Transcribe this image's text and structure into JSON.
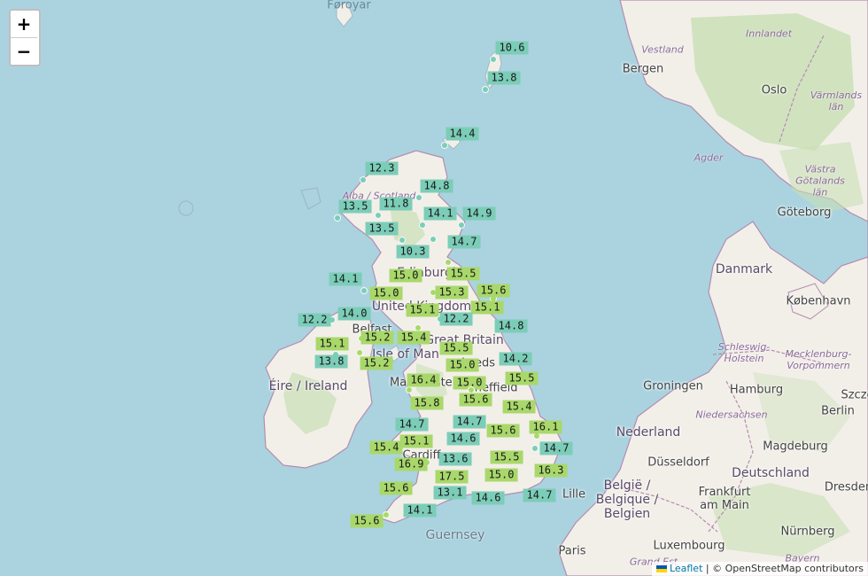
{
  "map": {
    "zoom_in_label": "+",
    "zoom_out_label": "−",
    "attribution": {
      "leaflet_link": "Leaflet",
      "separator": " | ",
      "credit": "© OpenStreetMap contributors"
    },
    "colors": {
      "sea": "#aad3df",
      "land": "#f2efe9",
      "forest": "#c8dfb4",
      "border": "#b48cb0",
      "marker_cool": "#7ccdb8",
      "marker_warm": "#a9d86a"
    },
    "places": {
      "foroyar": "Føroyar",
      "bergen": "Bergen",
      "vestland": "Vestland",
      "innlandet": "Innlandet",
      "oslo": "Oslo",
      "varmlands_lan": "Värmlands\nlän",
      "agder": "Agder",
      "vastra_gotalands_lan": "Västra Götalands\nlän",
      "goteborg": "Göteborg",
      "danmark": "Danmark",
      "kobenhavn": "København",
      "schleswig_holstein": "Schleswig-\nHolstein",
      "mecklenburg": "Mecklenburg-\nVorpommern",
      "hamburg": "Hamburg",
      "groningen": "Groningen",
      "szcz": "Szcze",
      "berlin": "Berlin",
      "niedersachsen": "Niedersachsen",
      "nederland": "Nederland",
      "magdeburg": "Magdeburg",
      "dusseldorf": "Düsseldorf",
      "deutschland": "Deutschland",
      "dresden": "Dresden",
      "belgie": "België /\nBelgique /\nBelgien",
      "frankfurt": "Frankfurt\nam Main",
      "lille": "Lille",
      "luxembourg": "Luxembourg",
      "nurnberg": "Nürnberg",
      "paris": "Paris",
      "grand_est": "Grand Est",
      "bayern": "Bayern",
      "guernsey": "Guernsey",
      "eire_ireland": "Éire / Ireland",
      "isle_of_man": "Isle of Man",
      "alba_scotland": "Alba / Scotland",
      "edinburgh": "Edinburgh",
      "united_kingdom": "United Kingdom",
      "belfast": "Belfast",
      "great_britain": "Great Britain",
      "leeds": "Leeds",
      "sheffield": "Sheffield",
      "manchester": "Manchester",
      "cardiff": "Cardiff"
    },
    "markers": [
      {
        "label": "10.6"
      },
      {
        "label": "13.8"
      },
      {
        "label": "14.4"
      },
      {
        "label": "12.3"
      },
      {
        "label": "14.8"
      },
      {
        "label": "13.5"
      },
      {
        "label": "11.8"
      },
      {
        "label": "14.1"
      },
      {
        "label": "14.9"
      },
      {
        "label": "13.5"
      },
      {
        "label": "14.7"
      },
      {
        "label": "10.3"
      },
      {
        "label": "15.0"
      },
      {
        "label": "15.5"
      },
      {
        "label": "14.1"
      },
      {
        "label": "15.0"
      },
      {
        "label": "15.3"
      },
      {
        "label": "15.6"
      },
      {
        "label": "15.1"
      },
      {
        "label": "15.1"
      },
      {
        "label": "12.2"
      },
      {
        "label": "14.0"
      },
      {
        "label": "12.2"
      },
      {
        "label": "14.8"
      },
      {
        "label": "15.2"
      },
      {
        "label": "15.4"
      },
      {
        "label": "15.1"
      },
      {
        "label": "15.5"
      },
      {
        "label": "13.8"
      },
      {
        "label": "15.2"
      },
      {
        "label": "15.0"
      },
      {
        "label": "14.2"
      },
      {
        "label": "16.4"
      },
      {
        "label": "15.0"
      },
      {
        "label": "15.5"
      },
      {
        "label": "15.6"
      },
      {
        "label": "15.8"
      },
      {
        "label": "15.4"
      },
      {
        "label": "14.7"
      },
      {
        "label": "14.7"
      },
      {
        "label": "15.6"
      },
      {
        "label": "16.1"
      },
      {
        "label": "15.1"
      },
      {
        "label": "14.6"
      },
      {
        "label": "15.4"
      },
      {
        "label": "14.7"
      },
      {
        "label": "13.6"
      },
      {
        "label": "15.5"
      },
      {
        "label": "16.9"
      },
      {
        "label": "16.3"
      },
      {
        "label": "17.5"
      },
      {
        "label": "15.0"
      },
      {
        "label": "15.6"
      },
      {
        "label": "13.1"
      },
      {
        "label": "14.6"
      },
      {
        "label": "14.7"
      },
      {
        "label": "14.1"
      },
      {
        "label": "15.6"
      }
    ]
  }
}
